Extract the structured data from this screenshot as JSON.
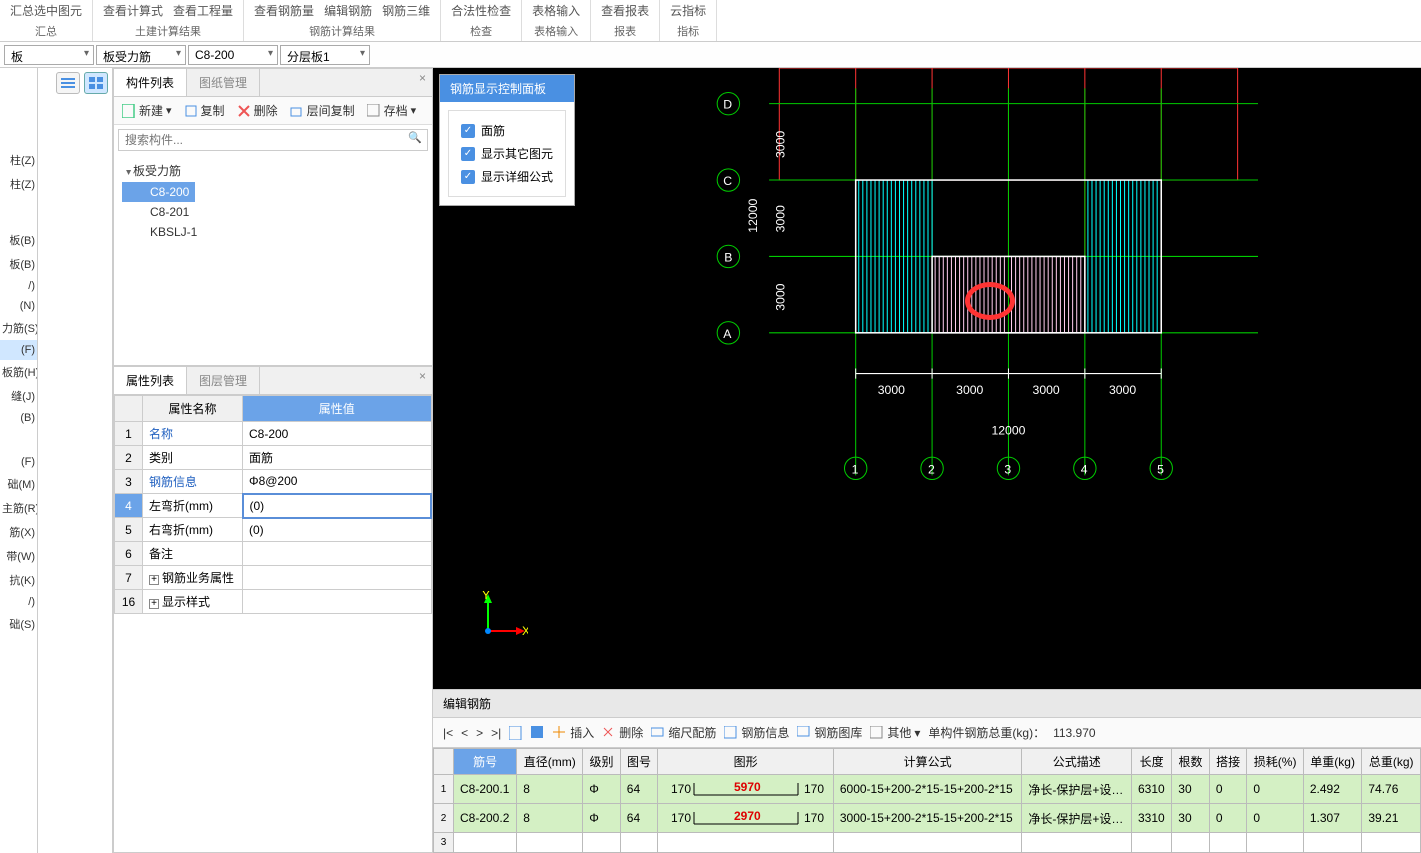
{
  "ribbon": {
    "groups": [
      {
        "label": "汇总",
        "items": [
          "汇总选中图元"
        ]
      },
      {
        "label": "土建计算结果",
        "items": [
          "查看计算式",
          "查看工程量"
        ]
      },
      {
        "label": "钢筋计算结果",
        "items": [
          "查看钢筋量",
          "编辑钢筋",
          "钢筋三维"
        ]
      },
      {
        "label": "检查",
        "items": [
          "合法性检查"
        ]
      },
      {
        "label": "表格输入",
        "items": [
          "表格输入"
        ]
      },
      {
        "label": "报表",
        "items": [
          "查看报表"
        ]
      },
      {
        "label": "指标",
        "items": [
          "云指标"
        ]
      }
    ]
  },
  "dropdowns": {
    "d1": "板",
    "d2": "板受力筋",
    "d3": "C8-200",
    "d4": "分层板1"
  },
  "leftItems": [
    "柱(Z)",
    "柱(Z)",
    "",
    "",
    "",
    "",
    "板(B)",
    "板(B)",
    "/)",
    "(N)",
    "力筋(S)",
    "(F)",
    "板筋(H)",
    "缝(J)",
    "(B)",
    "",
    "",
    "",
    "(F)",
    "础(M)",
    "主筋(R)",
    "筋(X)",
    "带(W)",
    "抗(K)",
    "/)",
    "础(S)"
  ],
  "leftActiveIndex": 11,
  "componentList": {
    "tabs": [
      "构件列表",
      "图纸管理"
    ],
    "toolbar": {
      "new": "新建",
      "copy": "复制",
      "delete": "删除",
      "floorCopy": "层间复制",
      "save": "存档"
    },
    "searchPlaceholder": "搜索构件...",
    "parent": "板受力筋",
    "items": [
      "C8-200",
      "C8-201",
      "KBSLJ-1"
    ],
    "selected": 0
  },
  "propList": {
    "tabs": [
      "属性列表",
      "图层管理"
    ],
    "headers": [
      "属性名称",
      "属性值"
    ],
    "rows": [
      {
        "n": "1",
        "name": "名称",
        "val": "C8-200",
        "link": true
      },
      {
        "n": "2",
        "name": "类别",
        "val": "面筋"
      },
      {
        "n": "3",
        "name": "钢筋信息",
        "val": "Φ8@200",
        "link": true
      },
      {
        "n": "4",
        "name": "左弯折(mm)",
        "val": "(0)",
        "editing": true
      },
      {
        "n": "5",
        "name": "右弯折(mm)",
        "val": "(0)"
      },
      {
        "n": "6",
        "name": "备注",
        "val": ""
      },
      {
        "n": "7",
        "name": "钢筋业务属性",
        "val": "",
        "expand": true
      },
      {
        "n": "16",
        "name": "显示样式",
        "val": "",
        "expand": true
      }
    ]
  },
  "floatPanel": {
    "title": "钢筋显示控制面板",
    "checks": [
      "面筋",
      "显示其它图元",
      "显示详细公式"
    ]
  },
  "drawing": {
    "rowLabels": [
      "D",
      "C",
      "B",
      "A"
    ],
    "colLabels": [
      "1",
      "2",
      "3",
      "4",
      "5"
    ],
    "vDim": "12000",
    "vSubDims": [
      "3000",
      "3000",
      "3000"
    ],
    "hDim": "12000",
    "hSubDims": [
      "3000",
      "3000",
      "3000",
      "3000"
    ]
  },
  "editRebar": {
    "title": "编辑钢筋",
    "toolbar": {
      "insert": "插入",
      "delete": "删除",
      "scale": "缩尺配筋",
      "info": "钢筋信息",
      "lib": "钢筋图库",
      "other": "其他",
      "weightLabel": "单构件钢筋总重(kg)：",
      "weight": "113.970"
    },
    "columns": [
      "筋号",
      "直径(mm)",
      "级别",
      "图号",
      "图形",
      "计算公式",
      "公式描述",
      "长度",
      "根数",
      "搭接",
      "损耗(%)",
      "单重(kg)",
      "总重(kg)"
    ],
    "rows": [
      {
        "num": "1",
        "id": "C8-200.1",
        "dia": "8",
        "grade": "Φ",
        "fig": "64",
        "l1": "170",
        "mid": "5970",
        "l2": "170",
        "formula": "6000-15+200-2*15-15+200-2*15",
        "desc": "净长-保护层+设…",
        "len": "6310",
        "cnt": "30",
        "lap": "0",
        "loss": "0",
        "unit": "2.492",
        "total": "74.76"
      },
      {
        "num": "2",
        "id": "C8-200.2",
        "dia": "8",
        "grade": "Φ",
        "fig": "64",
        "l1": "170",
        "mid": "2970",
        "l2": "170",
        "formula": "3000-15+200-2*15-15+200-2*15",
        "desc": "净长-保护层+设…",
        "len": "3310",
        "cnt": "30",
        "lap": "0",
        "loss": "0",
        "unit": "1.307",
        "total": "39.21"
      },
      {
        "num": "3"
      }
    ]
  }
}
